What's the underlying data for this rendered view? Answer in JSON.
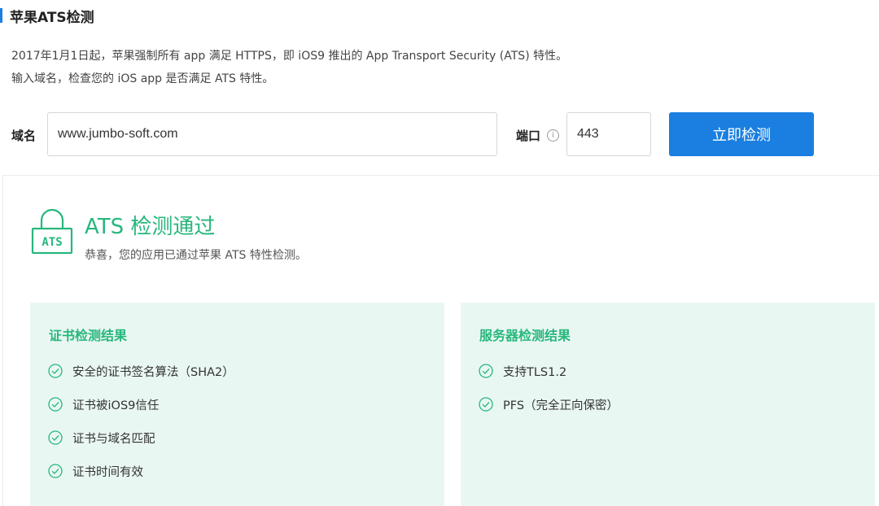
{
  "header": {
    "title": "苹果ATS检测"
  },
  "intro": {
    "line1": "2017年1月1日起，苹果强制所有 app 满足 HTTPS，即 iOS9 推出的 App Transport Security (ATS) 特性。",
    "line2": "输入域名，检查您的 iOS app 是否满足 ATS 特性。"
  },
  "form": {
    "domain_label": "域名",
    "domain_value": "www.jumbo-soft.com",
    "port_label": "端口",
    "port_value": "443",
    "info_symbol": "i",
    "submit_label": "立即检测"
  },
  "result": {
    "lock_text": "ATS",
    "title": "ATS 检测通过",
    "subtitle": "恭喜，您的应用已通过苹果 ATS 特性检测。"
  },
  "cert_card": {
    "title": "证书检测结果",
    "items": [
      "安全的证书签名算法（SHA2）",
      "证书被iOS9信任",
      "证书与域名匹配",
      "证书时间有效"
    ]
  },
  "server_card": {
    "title": "服务器检测结果",
    "items": [
      "支持TLS1.2",
      "PFS（完全正向保密）"
    ]
  },
  "colors": {
    "accent_blue": "#1a7fe0",
    "success_green": "#27b77c",
    "card_bg": "#e9f7f3"
  },
  "icons": {
    "lock": "lock-icon",
    "check": "check-circle-icon",
    "info": "info-icon"
  }
}
